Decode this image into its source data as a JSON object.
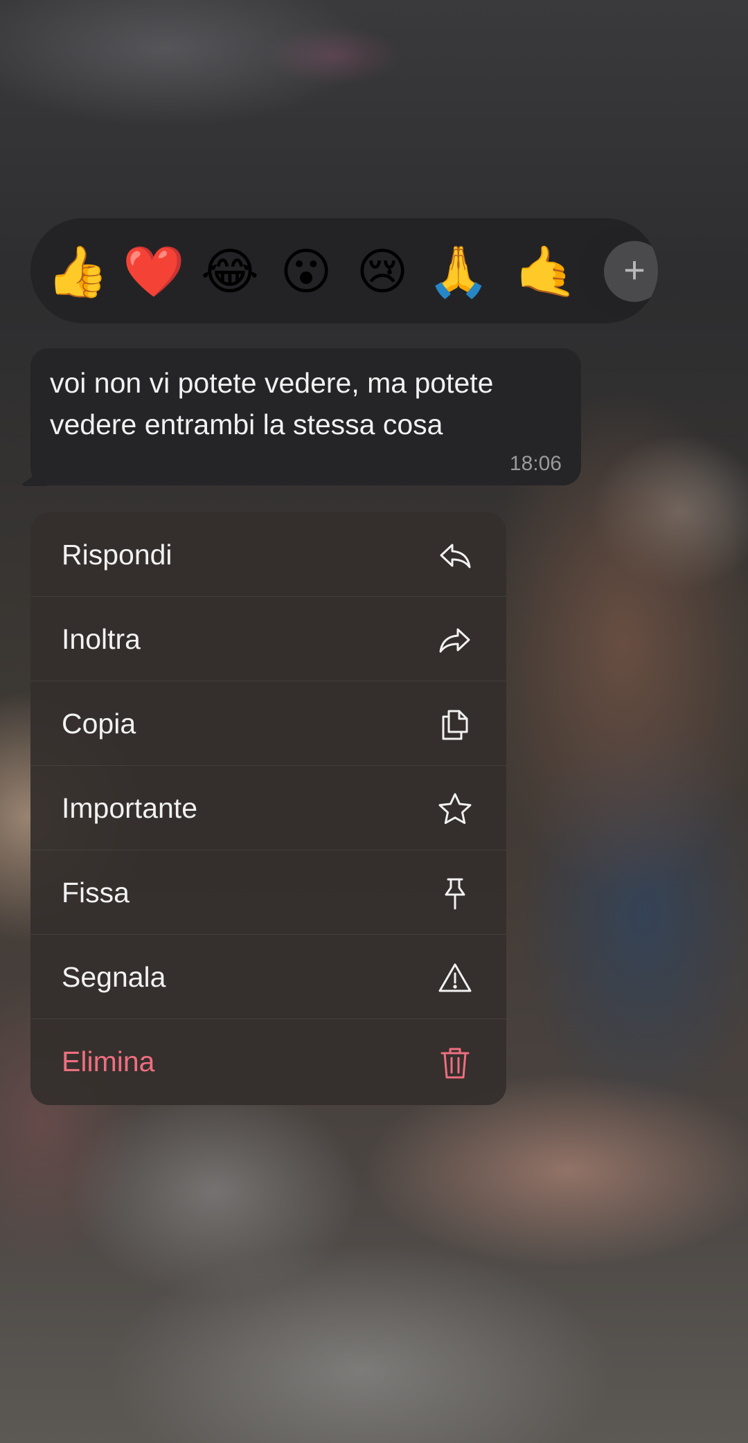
{
  "reactions": {
    "emojis": [
      "👍",
      "❤️",
      "😂",
      "😮",
      "😢",
      "🙏",
      "🤙"
    ],
    "more_icon": "plus-icon",
    "more_glyph": "+"
  },
  "message": {
    "line1": "voi non vi potete vedere, ma potete",
    "line2": "vedere entrambi la stessa cosa",
    "time": "18:06"
  },
  "menu": {
    "items": [
      {
        "label": "Rispondi",
        "icon": "reply-icon"
      },
      {
        "label": "Inoltra",
        "icon": "forward-icon"
      },
      {
        "label": "Copia",
        "icon": "copy-icon"
      },
      {
        "label": "Importante",
        "icon": "star-icon"
      },
      {
        "label": "Fissa",
        "icon": "pin-icon"
      },
      {
        "label": "Segnala",
        "icon": "warning-icon"
      },
      {
        "label": "Elimina",
        "icon": "trash-icon"
      }
    ]
  },
  "colors": {
    "danger": "#ee6f7f",
    "text": "#f2f2f2",
    "bubble": "#252527"
  }
}
